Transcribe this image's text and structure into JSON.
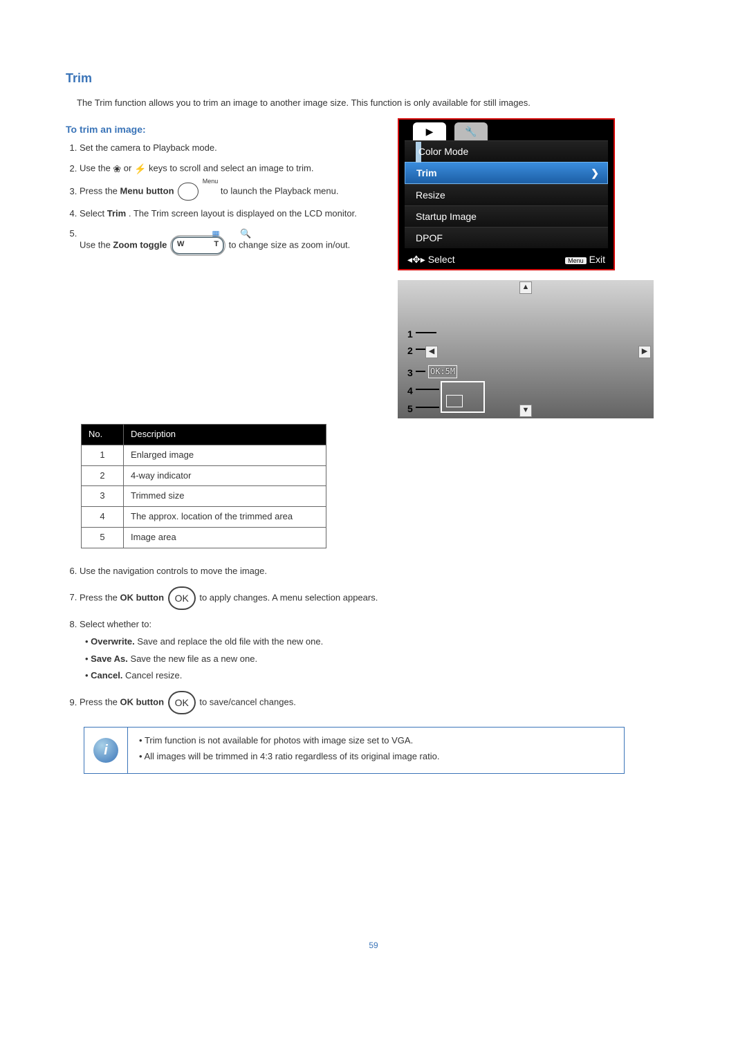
{
  "section_title": "Trim",
  "intro": "The Trim function allows you to trim an image to another image size. This function is only available for still images.",
  "subhead": "To trim an image:",
  "steps": {
    "1": "Set the camera to Playback mode.",
    "2a": "Use the ",
    "2b": " or ",
    "2c": " keys to scroll and select an image to trim.",
    "3a": "Press the ",
    "3b": "Menu button",
    "3c": " to launch the Playback menu.",
    "menu_label": "Menu",
    "4a": "Select ",
    "4b": "Trim",
    "4c": ". The Trim screen layout is displayed on the LCD monitor.",
    "5a": "Use the ",
    "5b": "Zoom toggle",
    "5c": " to change size as zoom in/out.",
    "zoom_w": "W",
    "zoom_t": "T",
    "6": "Use the navigation controls to move the image.",
    "7a": "Press the ",
    "7b": "OK button",
    "7c": " to apply changes. A menu selection appears.",
    "ok_label": "OK",
    "8": "Select whether to:",
    "8_1a": "Overwrite.",
    "8_1b": " Save and replace the old file with the new one.",
    "8_2a": "Save As.",
    "8_2b": " Save the new file as a new one.",
    "8_3a": "Cancel.",
    "8_3b": " Cancel resize.",
    "9a": "Press the ",
    "9b": "OK button",
    "9c": " to save/cancel changes."
  },
  "screen_menu": {
    "tab_play": "▶",
    "tab_setup": "🔧",
    "items": [
      "Color Mode",
      "Trim",
      "Resize",
      "Startup Image",
      "DPOF"
    ],
    "chevron": "❯",
    "footer_nav": "◂✥▸",
    "footer_select": "Select",
    "footer_menu_chip": "Menu",
    "footer_exit": "Exit"
  },
  "diagram": {
    "numbers": [
      "1",
      "2",
      "3",
      "4",
      "5"
    ],
    "ok_size": "OK:5M",
    "arrow_up": "▲",
    "arrow_down": "▼",
    "arrow_left": "◀",
    "arrow_right": "▶"
  },
  "table": {
    "head_no": "No.",
    "head_desc": "Description",
    "rows": [
      {
        "n": "1",
        "d": "Enlarged image"
      },
      {
        "n": "2",
        "d": "4-way indicator"
      },
      {
        "n": "3",
        "d": "Trimmed size"
      },
      {
        "n": "4",
        "d": "The approx. location of the trimmed area"
      },
      {
        "n": "5",
        "d": "Image area"
      }
    ]
  },
  "notes": [
    "Trim function is not available for photos with image size set to VGA.",
    "All images will be trimmed in 4:3 ratio regardless of its original image ratio."
  ],
  "page_number": "59"
}
